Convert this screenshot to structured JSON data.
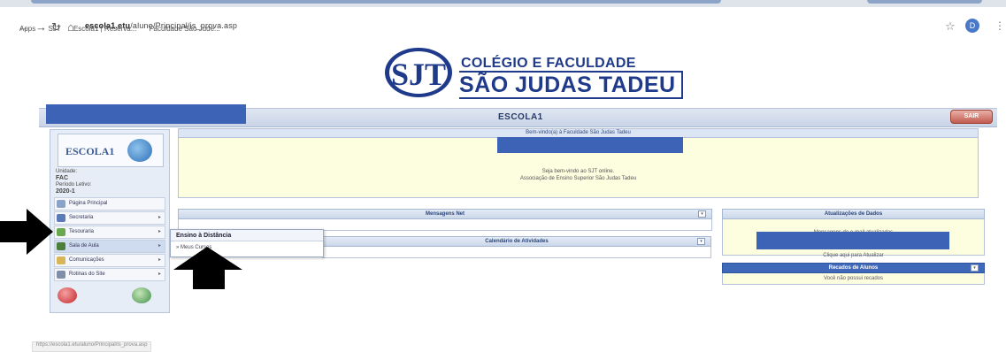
{
  "browser": {
    "url_host": "escola1.etu",
    "url_path": "/aluno/Principal/is_prova.asp",
    "bookmarks": [
      "Apps",
      "SJT",
      "Escola1 | Reserva...",
      "Faculdade São Jude..."
    ],
    "profile_letter": "D"
  },
  "logo": {
    "monogram": "SJT",
    "line1": "COLÉGIO E FACULDADE",
    "line2": "SÃO JUDAS TADEU"
  },
  "header": {
    "center_label": "ESCOLA1",
    "logout_label": "SAIR"
  },
  "sidebar": {
    "logo_text": "ESCOLA1",
    "unit_label": "Unidade:",
    "unit_value": "FAC",
    "period_label": "Período Letivo:",
    "period_value": "2020-1",
    "items": [
      {
        "label": "Página Principal"
      },
      {
        "label": "Secretaria"
      },
      {
        "label": "Tesouraria"
      },
      {
        "label": "Sala de Aula"
      },
      {
        "label": "Comunicações"
      },
      {
        "label": "Rotinas do Site"
      }
    ]
  },
  "dropdown": {
    "header": "Ensino à Distância",
    "item": "Meus Cursos"
  },
  "welcome": {
    "title": "Bem-vindo(a) à Faculdade São Judas Tadeu",
    "line1": "Seja bem-vindo ao SJT online.",
    "line2": "Associação de Ensino Superior São Judas Tadeu"
  },
  "panels": {
    "mensagens": "Mensagens Net",
    "calendario": "Calendário de Atividades",
    "right1_title": "Atualizações de Dados",
    "right1_under": "Mensagens de e-mail atualizadas",
    "right1_link": "Clique aqui para Atualizar",
    "right2_title": "Recados de Alunos",
    "right2_body": "Você não possui recados"
  },
  "statusbar": {
    "text": "https://escola1.etu/aluno/Principal/is_prova.asp"
  },
  "colors": {
    "brand_blue": "#1f3a8a",
    "redaction": "#3d63b7",
    "arrow": "#000000"
  }
}
